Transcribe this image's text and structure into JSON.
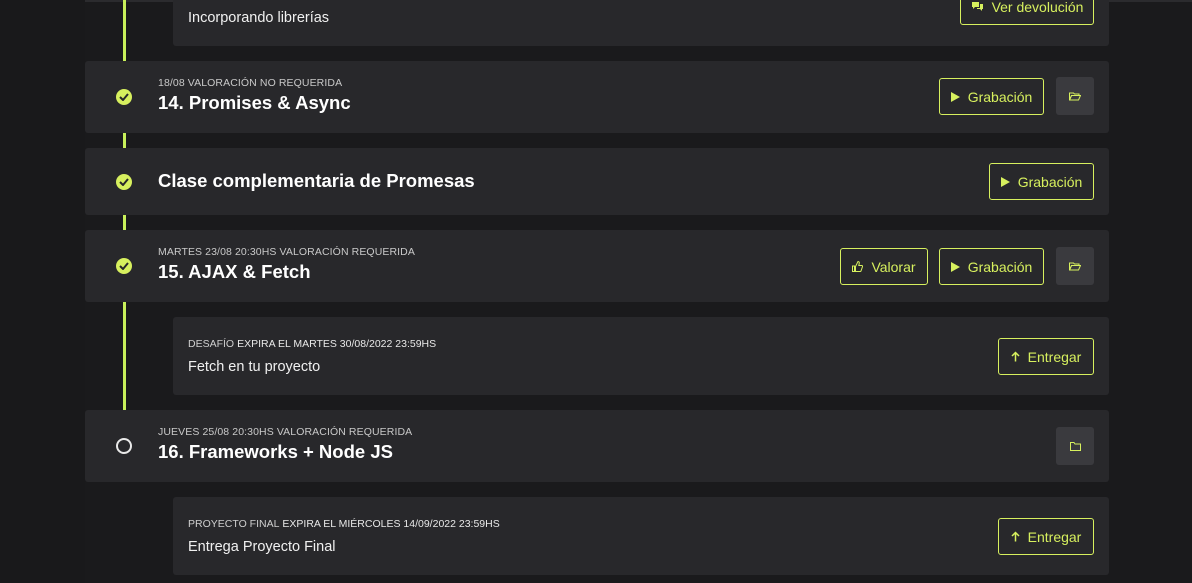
{
  "colors": {
    "accent": "#d7f05e",
    "card_bg": "#28282b",
    "page_bg": "#1a1a1c",
    "folder_btn_bg": "#3a3a3e"
  },
  "top_task": {
    "title": "Incorporando librerías",
    "button_label": "Ver devolución",
    "button_icon": "comments-icon"
  },
  "classes": [
    {
      "status": "completed",
      "meta": "18/08 VALORACIÓN NO REQUERIDA",
      "title": "14. Promises & Async",
      "recording_label": "Grabación"
    },
    {
      "status": "completed",
      "title": "Clase complementaria de Promesas",
      "recording_label": "Grabación"
    },
    {
      "status": "completed",
      "meta": "MARTES 23/08 20:30HS VALORACIÓN REQUERIDA",
      "title": "15. AJAX & Fetch",
      "rate_label": "Valorar",
      "recording_label": "Grabación"
    },
    {
      "status": "pending",
      "meta": "JUEVES 25/08 20:30HS VALORACIÓN REQUERIDA",
      "title": "16. Frameworks + Node JS"
    }
  ],
  "tasks": [
    {
      "type": "DESAFÍO",
      "expiry": "EXPIRA EL MARTES 30/08/2022 23:59HS",
      "title": "Fetch en tu proyecto",
      "button_label": "Entregar"
    },
    {
      "type": "PROYECTO FINAL",
      "expiry": "EXPIRA EL MIÉRCOLES 14/09/2022 23:59HS",
      "title": "Entrega Proyecto Final",
      "button_label": "Entregar"
    }
  ]
}
